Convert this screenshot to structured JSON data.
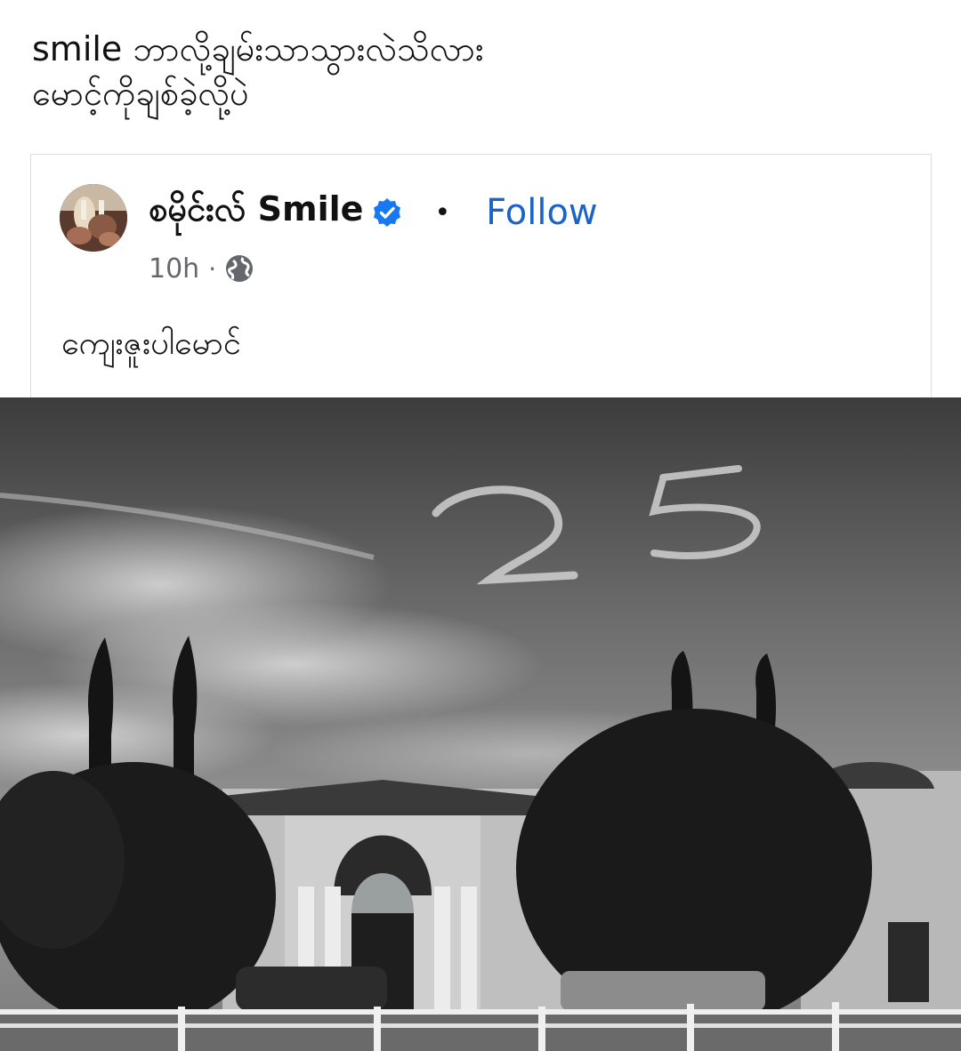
{
  "caption": {
    "line1": "smile ဘာလို့ချမ်းသာသွားလဲသိလား",
    "line2": "မောင့်ကိုချစ်ခဲ့လို့ပဲ"
  },
  "shared_post": {
    "author_name": "စမိုင်းလ် Smile",
    "verified": true,
    "separator": "•",
    "follow_label": "Follow",
    "time": "10h",
    "meta_separator": "·",
    "privacy_icon": "globe-icon",
    "text": "ကျေးဇူးပါမောင်",
    "photo": {
      "description_icon": "photo",
      "sky_writing": "25",
      "palette": "black-and-white"
    }
  },
  "colors": {
    "follow": "#1a64c8",
    "verified": "#1877f2",
    "meta": "#65676b"
  }
}
